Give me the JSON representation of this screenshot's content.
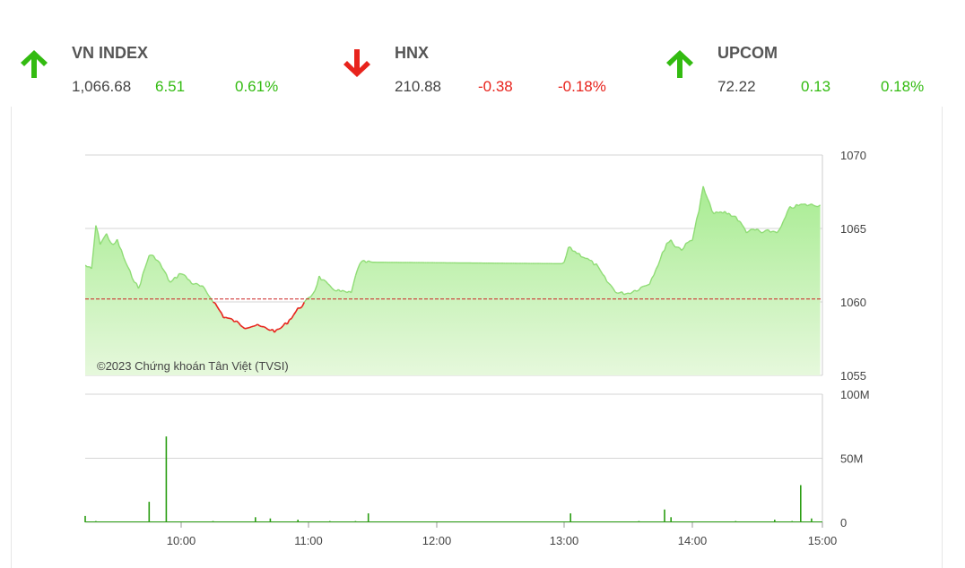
{
  "indices": [
    {
      "name": "VN INDEX",
      "value": "1,066.68",
      "change": "6.51",
      "percent": "0.61%",
      "direction": "up",
      "active": true
    },
    {
      "name": "HNX",
      "value": "210.88",
      "change": "-0.38",
      "percent": "-0.18%",
      "direction": "down",
      "active": false
    },
    {
      "name": "UPCOM",
      "value": "72.22",
      "change": "0.13",
      "percent": "0.18%",
      "direction": "up",
      "active": false
    }
  ],
  "colors": {
    "up": "#33bb11",
    "down": "#e8231c",
    "area_fill": "#a8ec92",
    "volume": "#2a9d12",
    "reference": "#cc2222"
  },
  "chart_data": [
    {
      "type": "area",
      "watermark": "©2023 Chứng khoán Tân Việt (TVSI)",
      "reference_value": 1060.2,
      "ylim": [
        1055,
        1070
      ],
      "yticks": [
        1055,
        1060,
        1065,
        1070
      ],
      "ytick_labels": [
        "1055",
        "1060",
        "1065",
        "1070"
      ],
      "xlim": [
        "09:15",
        "15:00"
      ],
      "series": [
        {
          "x": [
            "09:15",
            "09:18",
            "09:20",
            "09:22",
            "09:25",
            "09:28",
            "09:30",
            "09:35",
            "09:40",
            "09:45",
            "09:48",
            "09:50",
            "09:55",
            "10:00",
            "10:05",
            "10:10",
            "10:15",
            "10:20",
            "10:25",
            "10:30",
            "10:35",
            "10:40",
            "10:45",
            "10:50",
            "10:55",
            "11:00",
            "11:03",
            "11:05",
            "11:08",
            "11:10",
            "11:15",
            "11:20",
            "11:23",
            "11:25",
            "11:30",
            "13:00",
            "13:02",
            "13:10",
            "13:15",
            "13:20",
            "13:25",
            "13:30",
            "13:35",
            "13:40",
            "13:45",
            "13:48",
            "13:50",
            "13:52",
            "13:55",
            "14:00",
            "14:03",
            "14:05",
            "14:08",
            "14:10",
            "14:15",
            "14:20",
            "14:25",
            "14:30",
            "14:32",
            "14:35",
            "14:40",
            "14:45",
            "14:50",
            "14:55",
            "14:59"
          ],
          "y": [
            1062.5,
            1062.2,
            1065.2,
            1064.0,
            1064.6,
            1063.8,
            1064.2,
            1062.3,
            1060.9,
            1063.2,
            1063.0,
            1062.6,
            1061.3,
            1062.0,
            1061.3,
            1061.0,
            1060.1,
            1059.0,
            1058.7,
            1058.3,
            1058.4,
            1058.2,
            1058.0,
            1058.6,
            1059.5,
            1060.2,
            1060.8,
            1061.7,
            1061.3,
            1061.0,
            1060.7,
            1060.6,
            1062.3,
            1062.7,
            1062.7,
            1062.6,
            1063.7,
            1063.0,
            1062.5,
            1061.4,
            1060.6,
            1060.6,
            1060.9,
            1061.3,
            1062.9,
            1064.0,
            1064.2,
            1063.8,
            1063.6,
            1064.3,
            1066.2,
            1067.8,
            1066.6,
            1066.0,
            1066.1,
            1065.8,
            1064.8,
            1064.9,
            1064.7,
            1064.8,
            1064.8,
            1066.4,
            1066.6,
            1066.6,
            1066.6
          ]
        }
      ]
    },
    {
      "type": "bar",
      "ylim": [
        0,
        100
      ],
      "yticks": [
        0,
        50,
        100
      ],
      "ytick_labels": [
        "0",
        "50M",
        "100M"
      ],
      "xticks": [
        "10:00",
        "11:00",
        "12:00",
        "13:00",
        "14:00",
        "15:00"
      ],
      "series": [
        {
          "unit": "M",
          "x": [
            "09:15",
            "09:20",
            "09:45",
            "09:53",
            "10:15",
            "10:35",
            "10:42",
            "10:55",
            "11:10",
            "11:22",
            "11:28",
            "13:03",
            "13:35",
            "13:47",
            "13:50",
            "14:20",
            "14:38",
            "14:46",
            "14:50",
            "14:55"
          ],
          "y": [
            5,
            1,
            16,
            67,
            1,
            4,
            3,
            2,
            1,
            1,
            7,
            7,
            1,
            10,
            4,
            1,
            2,
            1,
            29,
            3
          ]
        }
      ]
    }
  ]
}
